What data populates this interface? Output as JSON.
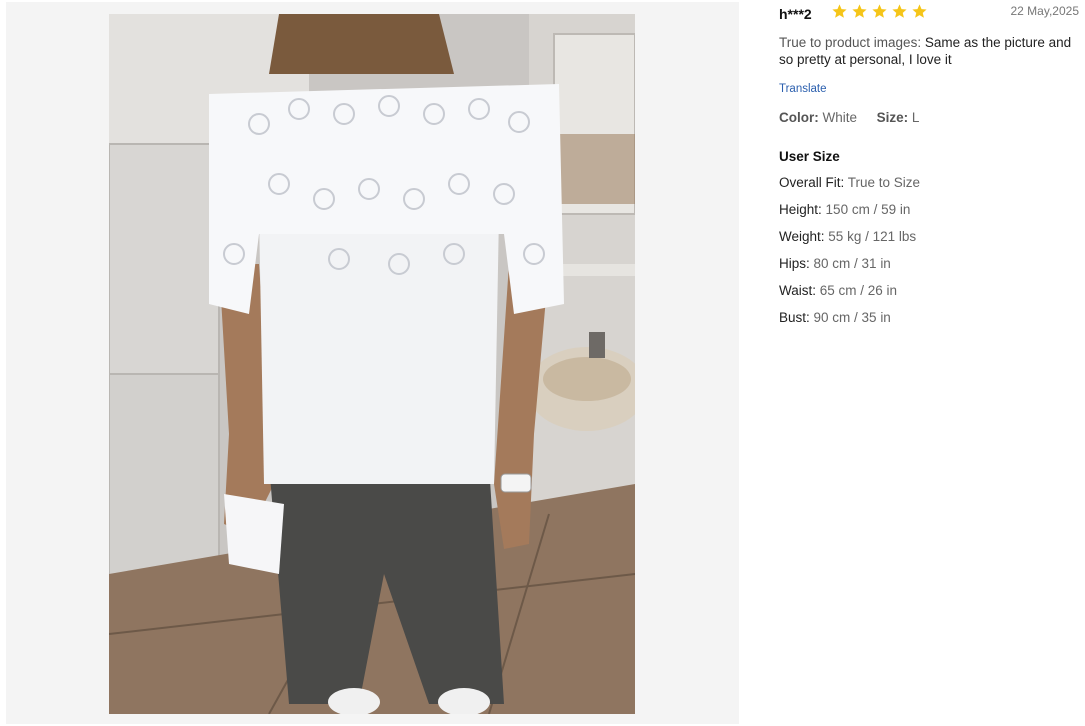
{
  "review": {
    "reviewer": "h***2",
    "rating": 5,
    "star_color": "#f5c518",
    "date": "22 May,2025",
    "text_label": "True to product images:",
    "text_body": "Same as the picture and so pretty at personal, I love it",
    "translate_label": "Translate",
    "color_label": "Color:",
    "color_value": "White",
    "size_label": "Size:",
    "size_value": "L"
  },
  "user_size": {
    "title": "User Size",
    "rows": [
      {
        "label": "Overall Fit:",
        "value": "True to Size"
      },
      {
        "label": "Height:",
        "value": "150 cm / 59 in"
      },
      {
        "label": "Weight:",
        "value": "55 kg / 121 lbs"
      },
      {
        "label": "Hips:",
        "value": "80 cm / 31 in"
      },
      {
        "label": "Waist:",
        "value": "65 cm / 26 in"
      },
      {
        "label": "Bust:",
        "value": "90 cm / 35 in"
      }
    ]
  },
  "photo": {
    "icon": "review-photo"
  }
}
